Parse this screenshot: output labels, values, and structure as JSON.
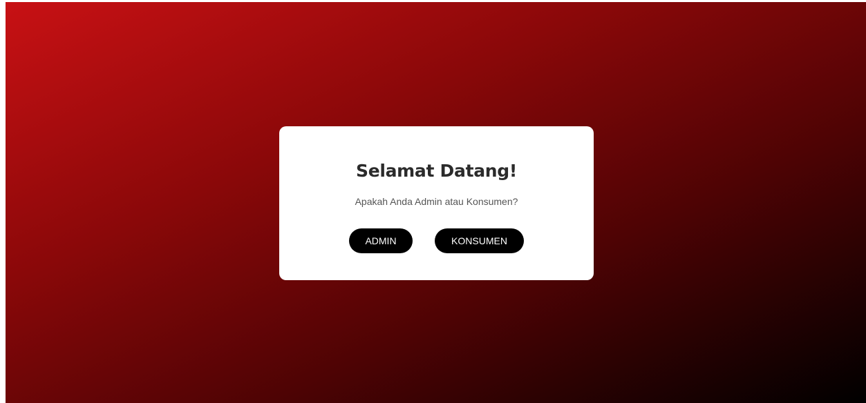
{
  "dialog": {
    "title": "Selamat Datang!",
    "subtitle": "Apakah Anda Admin atau Konsumen?",
    "buttons": {
      "admin_label": "ADMIN",
      "konsumen_label": "KONSUMEN"
    }
  },
  "colors": {
    "background_gradient_start": "#c81114",
    "background_gradient_end": "#000000",
    "card": "#ffffff",
    "button": "#000000",
    "button_text": "#ffffff"
  }
}
